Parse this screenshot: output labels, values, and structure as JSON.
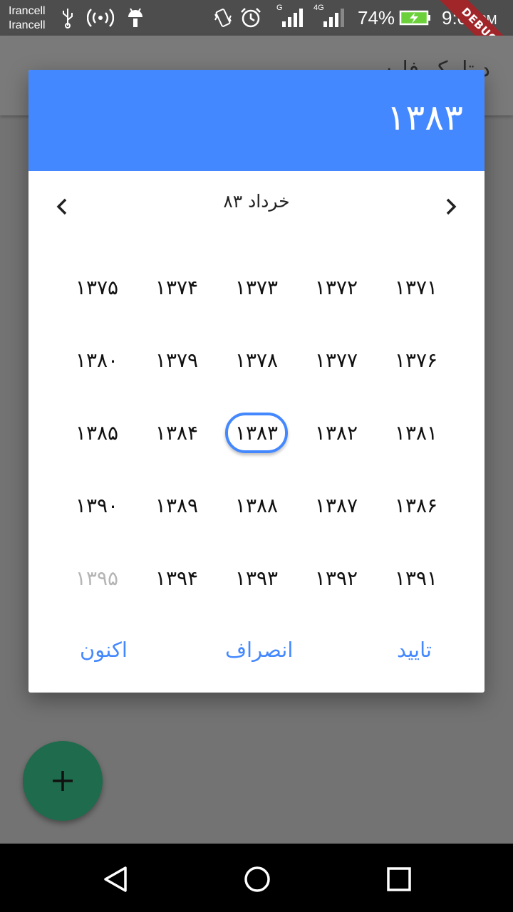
{
  "status_bar": {
    "carrier_line1": "Irancell",
    "carrier_line2": "Irancell",
    "network_label_1": "G",
    "network_label_2": "4G",
    "battery_percent": "74%",
    "time": "9:04",
    "ampm": "PM",
    "debug_banner": "DEBUG"
  },
  "app_bar": {
    "title": "دیتاپیکر فارسی"
  },
  "dialog": {
    "header_year": "۱۳۸۳",
    "month_label": "خرداد ۸۳",
    "years": [
      "۱۳۷۱",
      "۱۳۷۲",
      "۱۳۷۳",
      "۱۳۷۴",
      "۱۳۷۵",
      "۱۳۷۶",
      "۱۳۷۷",
      "۱۳۷۸",
      "۱۳۷۹",
      "۱۳۸۰",
      "۱۳۸۱",
      "۱۳۸۲",
      "۱۳۸۳",
      "۱۳۸۴",
      "۱۳۸۵",
      "۱۳۸۶",
      "۱۳۸۷",
      "۱۳۸۸",
      "۱۳۸۹",
      "۱۳۹۰",
      "۱۳۹۱",
      "۱۳۹۲",
      "۱۳۹۳",
      "۱۳۹۴",
      "۱۳۹۵"
    ],
    "selected_year": "۱۳۸۳",
    "disabled_year": "۱۳۹۵",
    "confirm_label": "تایید",
    "cancel_label": "انصراف",
    "now_label": "اکنون"
  },
  "fab": {
    "icon": "plus-icon"
  },
  "colors": {
    "accent": "#4488ff",
    "fab": "#1f6b4d",
    "scrim": "#737373"
  }
}
